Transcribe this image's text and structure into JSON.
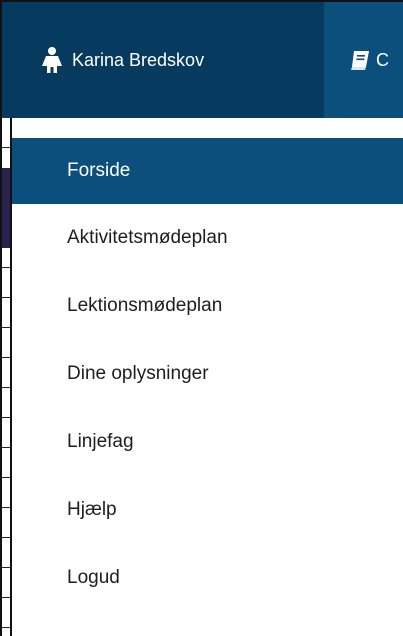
{
  "navbar": {
    "user_name": "Karina Bredskov",
    "user_icon": "female-user-icon",
    "next_label": "C",
    "next_icon": "book-icon"
  },
  "menu": {
    "items": [
      {
        "label": "Forside",
        "active": true
      },
      {
        "label": "Aktivitetsmødeplan",
        "active": false
      },
      {
        "label": "Lektionsmødeplan",
        "active": false
      },
      {
        "label": "Dine oplysninger",
        "active": false
      },
      {
        "label": "Linjefag",
        "active": false
      },
      {
        "label": "Hjælp",
        "active": false
      },
      {
        "label": "Logud",
        "active": false
      }
    ]
  },
  "colors": {
    "navbar_bg": "#0b4f7c",
    "user_tab_bg": "#063a5e",
    "active_bg": "#0b4f7c",
    "text": "#1e1e1e"
  }
}
